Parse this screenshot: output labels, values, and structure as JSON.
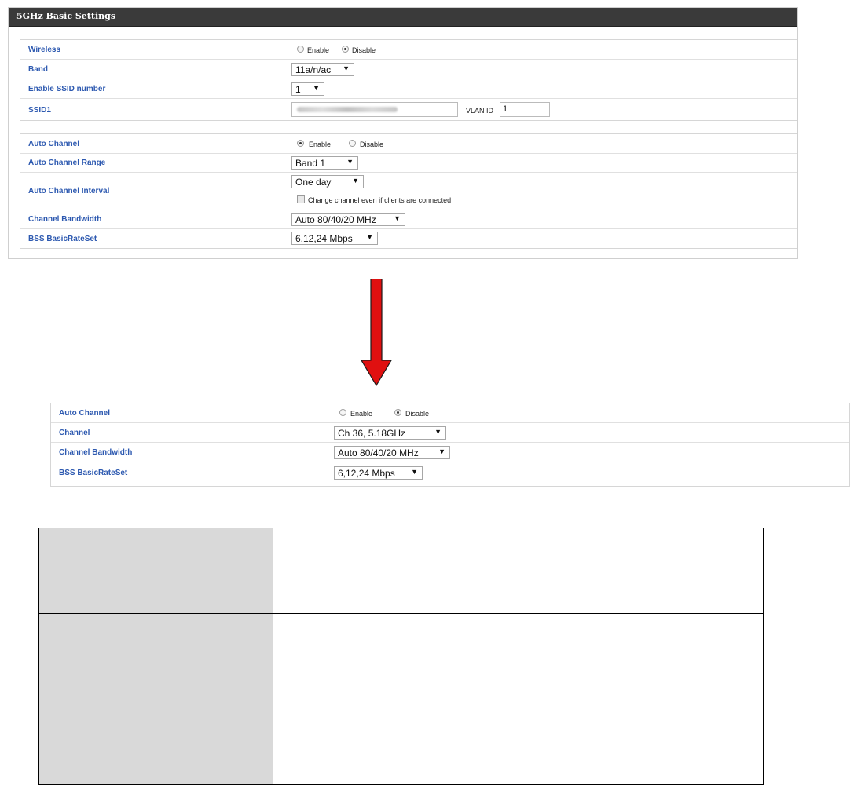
{
  "panel1": {
    "title": "5GHz Basic Settings",
    "wireless": {
      "label": "Wireless",
      "enable": "Enable",
      "disable": "Disable",
      "selected": "disable"
    },
    "band": {
      "label": "Band",
      "value": "11a/n/ac"
    },
    "ssid_number": {
      "label": "Enable SSID number",
      "value": "1"
    },
    "ssid1": {
      "label": "SSID1",
      "vlan_label": "VLAN ID",
      "vlan_value": "1"
    },
    "auto_channel": {
      "label": "Auto Channel",
      "enable": "Enable",
      "disable": "Disable",
      "selected": "enable"
    },
    "auto_channel_range": {
      "label": "Auto Channel Range",
      "value": "Band 1"
    },
    "auto_channel_interval": {
      "label": "Auto Channel Interval",
      "value": "One day",
      "checkbox_label": "Change channel even if clients are connected",
      "checked": false
    },
    "channel_bandwidth": {
      "label": "Channel Bandwidth",
      "value": "Auto 80/40/20 MHz"
    },
    "bss_rate": {
      "label": "BSS BasicRateSet",
      "value": "6,12,24 Mbps"
    }
  },
  "arrow": {
    "color": "#e01010",
    "icon": "down-arrow-icon"
  },
  "panel2": {
    "auto_channel": {
      "label": "Auto Channel",
      "enable": "Enable",
      "disable": "Disable",
      "selected": "disable"
    },
    "channel": {
      "label": "Channel",
      "value": "Ch 36, 5.18GHz"
    },
    "channel_bandwidth": {
      "label": "Channel Bandwidth",
      "value": "Auto 80/40/20 MHz"
    },
    "bss_rate": {
      "label": "BSS BasicRateSet",
      "value": "6,12,24 Mbps"
    }
  },
  "table": {
    "rows": 3
  },
  "colors": {
    "label_blue": "#2d59b0",
    "header_dark": "#3a3a3a",
    "table_key_bg": "#d9d9d9"
  }
}
